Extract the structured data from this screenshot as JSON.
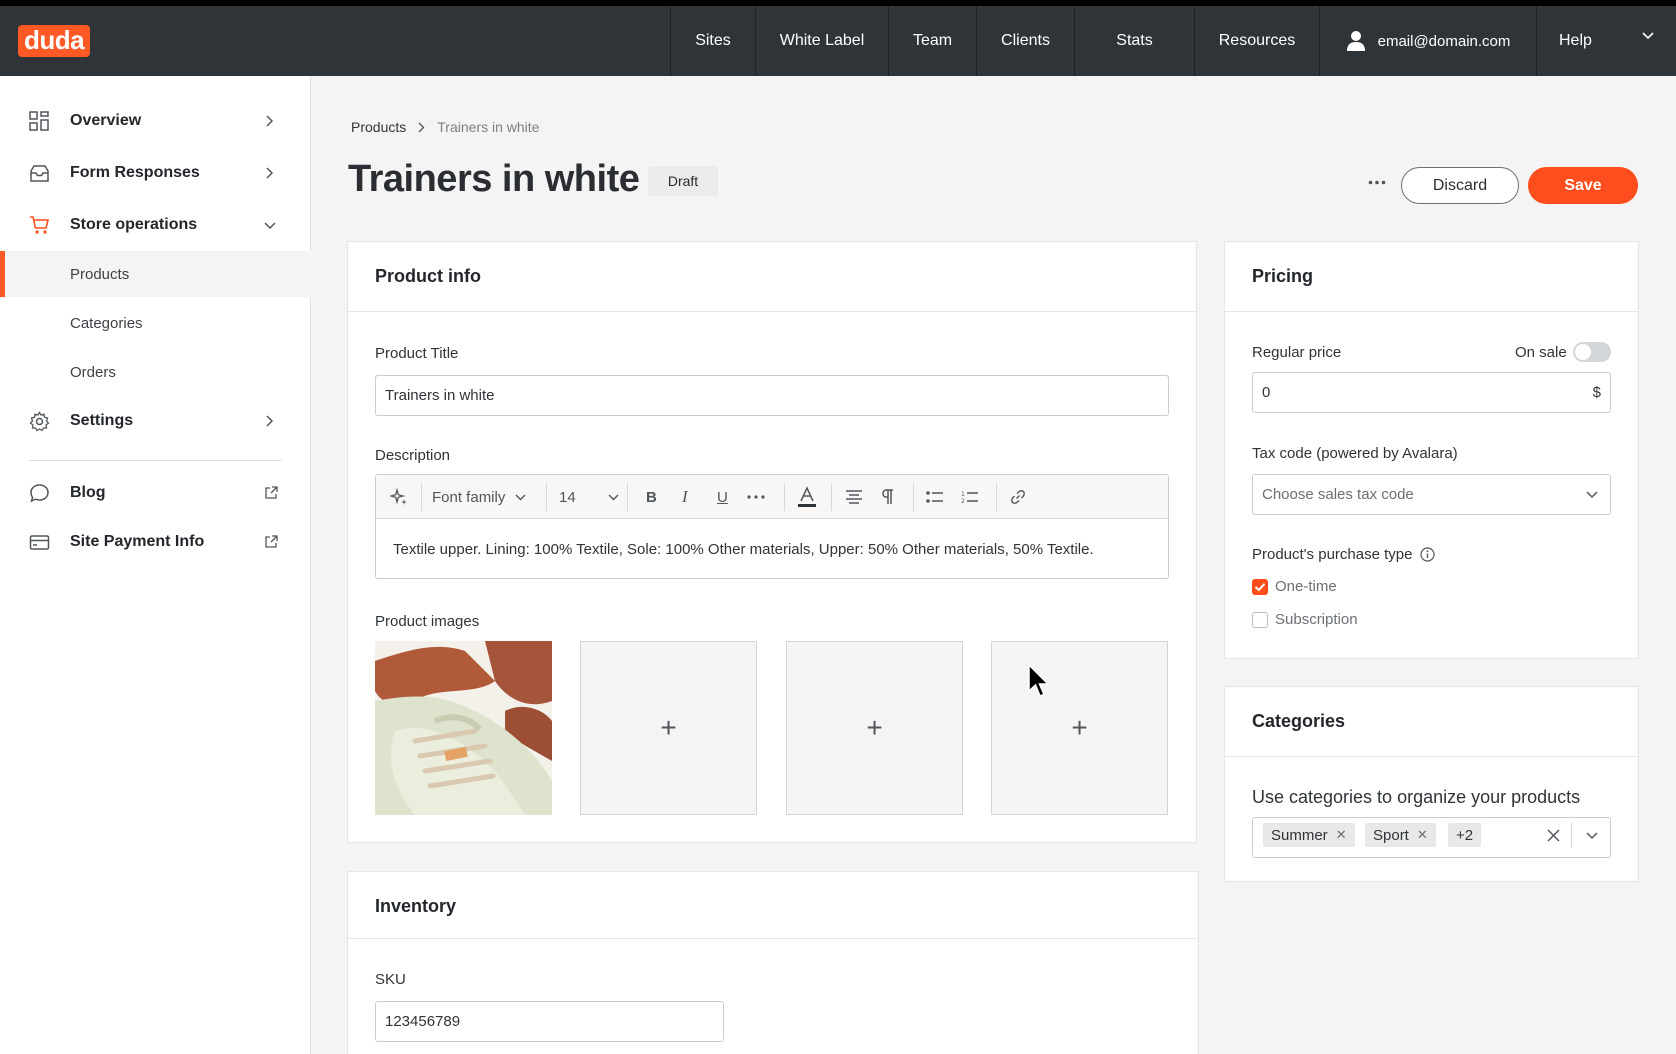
{
  "brand": {
    "logo_text": "duda",
    "accent_color": "#ff4d1d",
    "topbar_color": "#2e3438"
  },
  "topnav": {
    "items": [
      "Sites",
      "White Label",
      "Team",
      "Clients",
      "Stats",
      "Resources"
    ],
    "user_email": "email@domain.com",
    "help": "Help",
    "icons": {
      "user": "user-icon",
      "help_chevron": "chevron-down-icon"
    }
  },
  "sidebar": {
    "items": [
      {
        "label": "Overview",
        "icon": "grid-icon"
      },
      {
        "label": "Form Responses",
        "icon": "inbox-icon"
      },
      {
        "label": "Store operations",
        "icon": "cart-icon"
      },
      {
        "label": "Settings",
        "icon": "gear-icon"
      },
      {
        "label": "Blog",
        "icon": "chat-bubble-icon"
      },
      {
        "label": "Site Payment Info",
        "icon": "credit-card-icon"
      }
    ],
    "store_subitems": [
      "Products",
      "Categories",
      "Orders"
    ],
    "active_subitem": "Products"
  },
  "breadcrumb": {
    "parent": "Products",
    "current": "Trainers in white"
  },
  "header": {
    "title": "Trainers in white",
    "status": "Draft",
    "discard": "Discard",
    "save": "Save"
  },
  "product_info": {
    "heading": "Product info",
    "title_label": "Product Title",
    "title_value": "Trainers in white",
    "description_label": "Description",
    "toolbar": {
      "font_family": "Font family",
      "font_size": "14"
    },
    "description_text": "Textile upper. Lining: 100% Textile, Sole: 100% Other materials, Upper: 50% Other materials, 50% Textile.",
    "images_label": "Product images",
    "add_symbol": "+"
  },
  "inventory": {
    "heading": "Inventory",
    "sku_label": "SKU",
    "sku_value": "123456789"
  },
  "pricing": {
    "heading": "Pricing",
    "regular_price_label": "Regular price",
    "on_sale_label": "On sale",
    "on_sale": false,
    "price_value": "0",
    "currency": "$",
    "tax_label": "Tax code (powered by Avalara)",
    "tax_placeholder": "Choose sales tax code",
    "purchase_type_label": "Product's purchase type",
    "one_time": "One-time",
    "one_time_checked": true,
    "subscription": "Subscription",
    "subscription_checked": false
  },
  "categories": {
    "heading": "Categories",
    "helper": "Use categories to organize your products",
    "tags": [
      "Summer",
      "Sport"
    ],
    "more": "+2"
  }
}
